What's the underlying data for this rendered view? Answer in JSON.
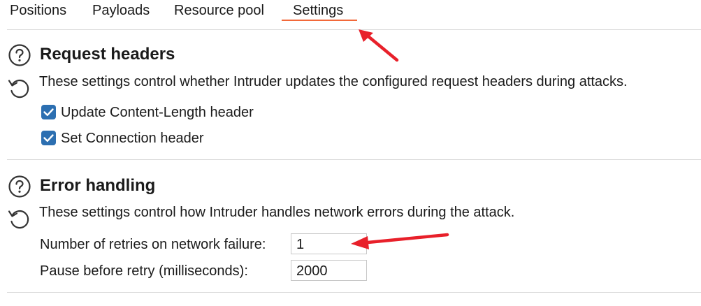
{
  "tabs": [
    {
      "label": "Positions",
      "active": false
    },
    {
      "label": "Payloads",
      "active": false
    },
    {
      "label": "Resource pool",
      "active": false
    },
    {
      "label": "Settings",
      "active": true
    }
  ],
  "accent_color": "#f2693a",
  "checkbox_color": "#2c6fb1",
  "annotation_arrow_color": "#e8202a",
  "request_headers": {
    "title": "Request headers",
    "description": "These settings control whether Intruder updates the configured request headers during attacks.",
    "options": [
      {
        "label": "Update Content-Length header",
        "checked": true
      },
      {
        "label": "Set Connection header",
        "checked": true
      }
    ]
  },
  "error_handling": {
    "title": "Error handling",
    "description": "These settings control how Intruder handles network errors during the attack.",
    "retries_label": "Number of retries on network failure:",
    "retries_value": "1",
    "pause_label": "Pause before retry (milliseconds):",
    "pause_value": "2000"
  },
  "icons": {
    "help": "help-circle-icon",
    "reset": "reset-icon",
    "checkbox": "checkmark-icon",
    "annotation": "red-arrow-icon"
  }
}
